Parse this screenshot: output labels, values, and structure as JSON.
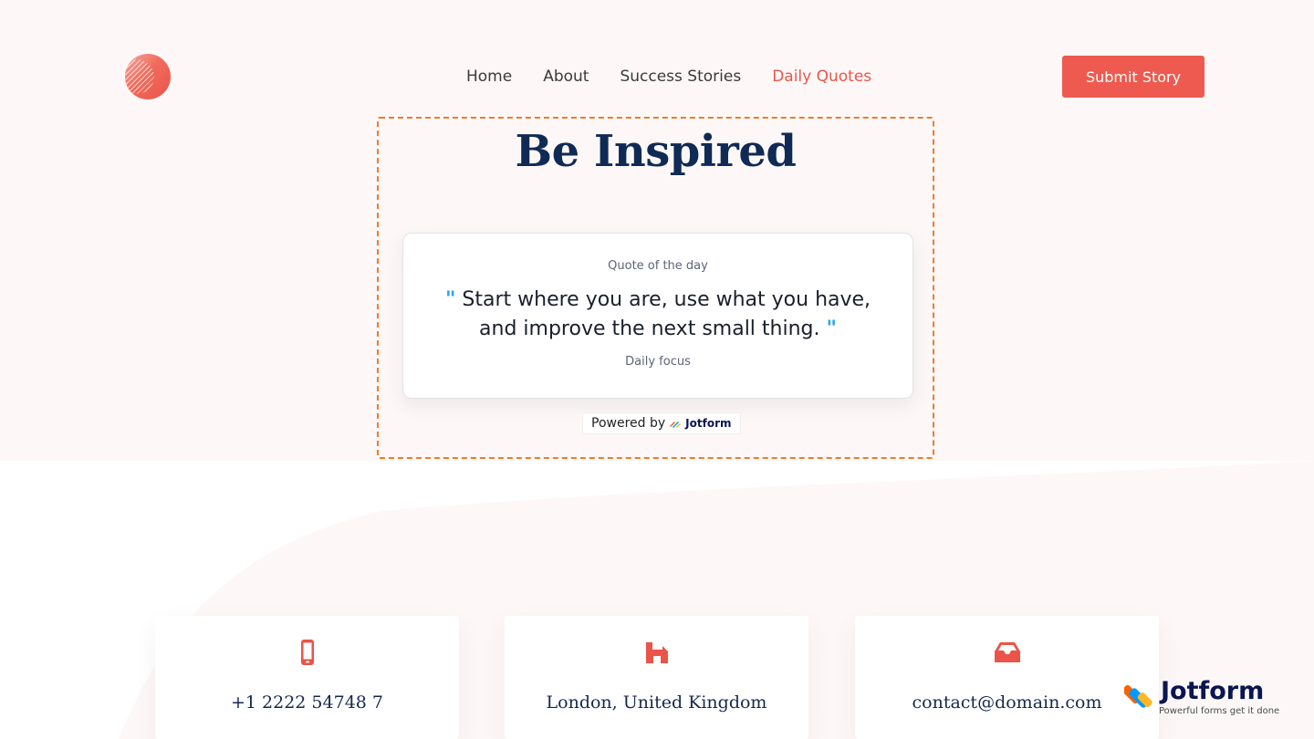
{
  "nav": {
    "items": [
      {
        "label": "Home",
        "active": false
      },
      {
        "label": "About",
        "active": false
      },
      {
        "label": "Success Stories",
        "active": false
      },
      {
        "label": "Daily Quotes",
        "active": true
      }
    ],
    "submit_label": "Submit Story"
  },
  "hero": {
    "title": "Be Inspired",
    "quote_label": "Quote of the day",
    "quote_text": "Start where you are, use what you have, and improve the next small thing.",
    "quote_author": "Daily focus",
    "powered_by": "Powered by",
    "powered_brand": "Jotform"
  },
  "contacts": [
    {
      "icon": "phone-icon",
      "value": "+1 2222 54748 7"
    },
    {
      "icon": "home-icon",
      "value": "London, United Kingdom"
    },
    {
      "icon": "inbox-icon",
      "value": "contact@domain.com"
    }
  ],
  "badge": {
    "name": "Jotform",
    "tagline": "Powerful forms get it done"
  },
  "colors": {
    "accent": "#ee5a4f",
    "navy": "#0f2a55",
    "quote_mark": "#2ea4e8",
    "frame": "#f07a2a"
  }
}
